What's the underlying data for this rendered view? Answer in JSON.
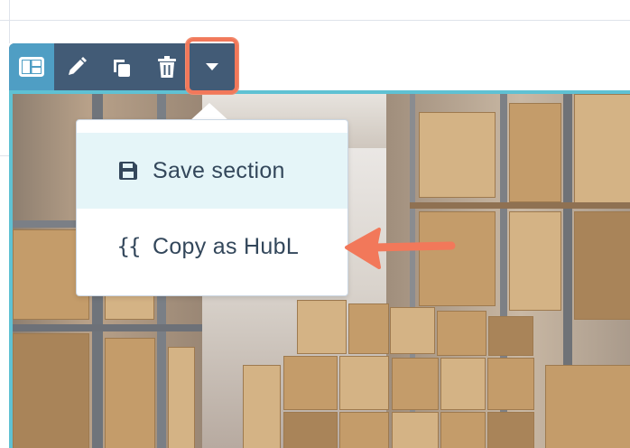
{
  "toolbar": {
    "buttons": [
      {
        "name": "layout",
        "icon": "layout-icon"
      },
      {
        "name": "edit",
        "icon": "pencil-icon"
      },
      {
        "name": "clone",
        "icon": "clone-icon"
      },
      {
        "name": "delete",
        "icon": "trash-icon"
      },
      {
        "name": "more",
        "icon": "caret-down-icon"
      }
    ],
    "highlight_color": "#f2785a",
    "background": "#425b76",
    "active_color": "#4f9ec4"
  },
  "menu": {
    "items": [
      {
        "label": "Save section",
        "icon": "save-icon"
      },
      {
        "label": "Copy as HubL",
        "icon": "curly-braces-icon",
        "icon_text": "{{"
      }
    ]
  },
  "annotation": {
    "arrow_color": "#f2785a"
  },
  "section_border_color": "#5fc1d3"
}
